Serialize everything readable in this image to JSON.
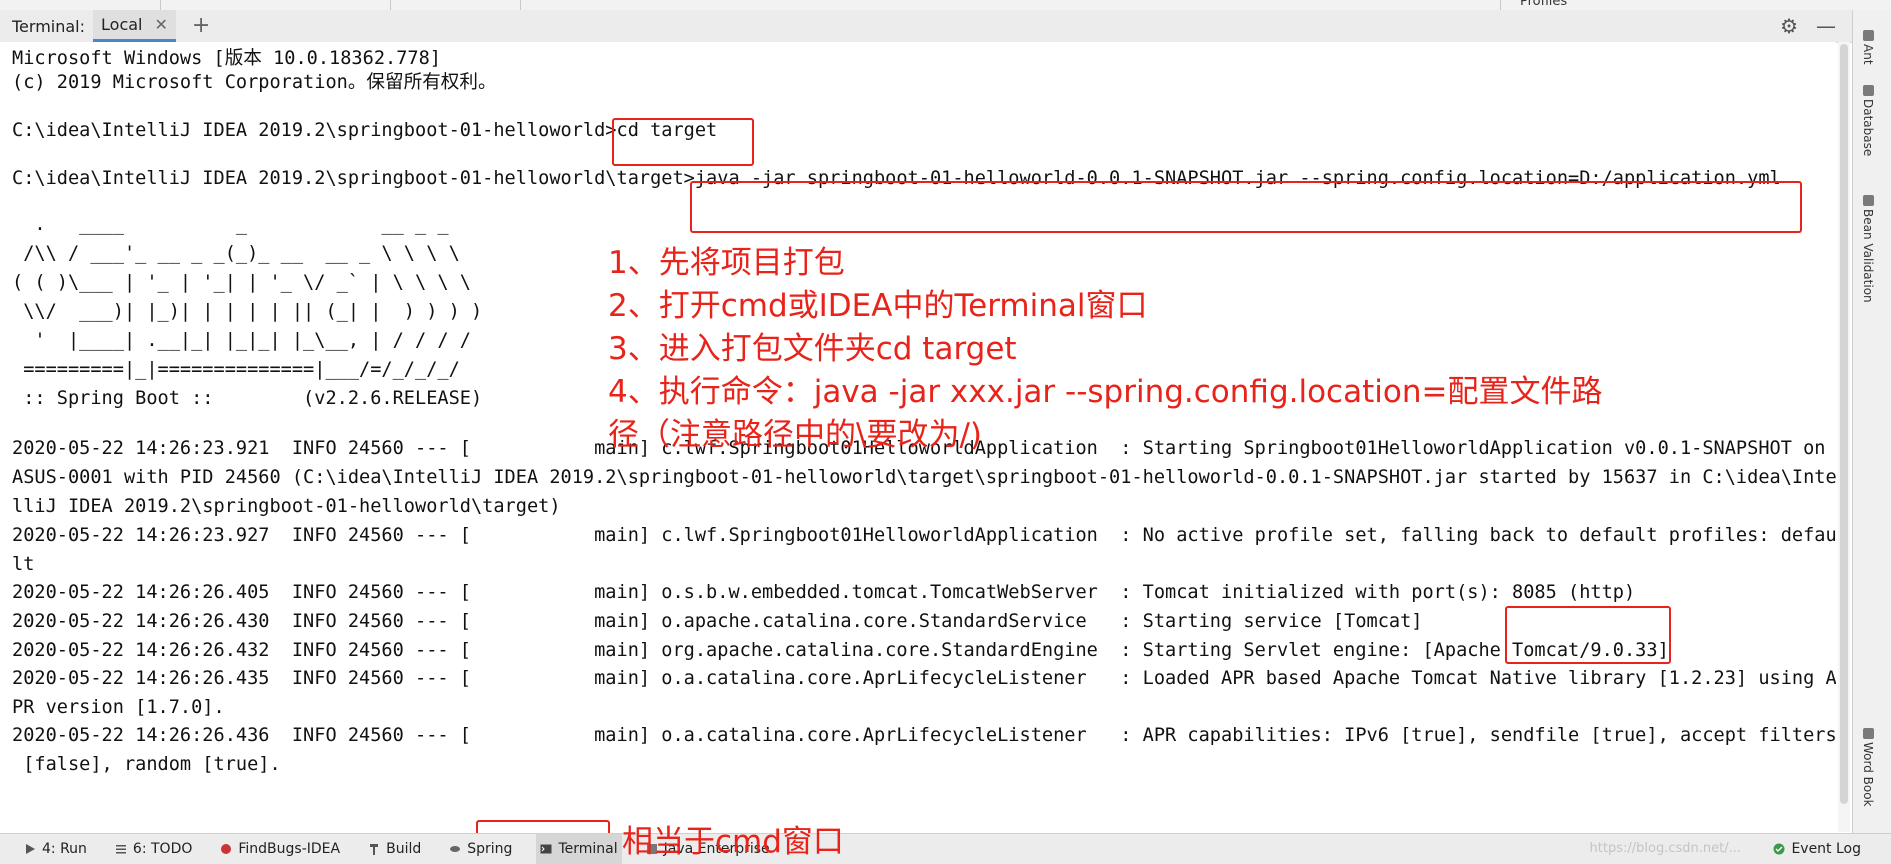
{
  "top_strip": {
    "profiles_label": "Profiles"
  },
  "tool_window": {
    "title": "Terminal:",
    "tab_local": "Local",
    "close_glyph": "✕",
    "add_glyph": "+"
  },
  "terminal": {
    "lines": [
      "Microsoft Windows [版本 10.0.18362.778]",
      "(c) 2019 Microsoft Corporation。保留所有权利。",
      "",
      "C:\\idea\\IntelliJ IDEA 2019.2\\springboot-01-helloworld>cd target",
      "",
      "C:\\idea\\IntelliJ IDEA 2019.2\\springboot-01-helloworld\\target>java -jar springboot-01-helloworld-0.0.1-SNAPSHOT.jar --spring.config.location=D:/application.yml"
    ],
    "banner": [
      "  .   ____          _            __ _ _",
      " /\\\\ / ___'_ __ _ _(_)_ __  __ _ \\ \\ \\ \\",
      "( ( )\\___ | '_ | '_| | '_ \\/ _` | \\ \\ \\ \\",
      " \\\\/  ___)| |_)| | | | | || (_| |  ) ) ) )",
      "  '  |____| .__|_| |_|_| |_\\__, | / / / /",
      " =========|_|==============|___/=/_/_/_/",
      " :: Spring Boot ::        (v2.2.6.RELEASE)"
    ],
    "log": [
      "2020-05-22 14:26:23.921  INFO 24560 --- [           main] c.lwf.Springboot01HelloworldApplication  : Starting Springboot01HelloworldApplication v0.0.1-SNAPSHOT on",
      "ASUS-0001 with PID 24560 (C:\\idea\\IntelliJ IDEA 2019.2\\springboot-01-helloworld\\target\\springboot-01-helloworld-0.0.1-SNAPSHOT.jar started by 15637 in C:\\idea\\Inte",
      "lliJ IDEA 2019.2\\springboot-01-helloworld\\target)",
      "2020-05-22 14:26:23.927  INFO 24560 --- [           main] c.lwf.Springboot01HelloworldApplication  : No active profile set, falling back to default profiles: defau",
      "lt",
      "2020-05-22 14:26:26.405  INFO 24560 --- [           main] o.s.b.w.embedded.tomcat.TomcatWebServer  : Tomcat initialized with port(s): 8085 (http)",
      "2020-05-22 14:26:26.430  INFO 24560 --- [           main] o.apache.catalina.core.StandardService   : Starting service [Tomcat]",
      "2020-05-22 14:26:26.432  INFO 24560 --- [           main] org.apache.catalina.core.StandardEngine  : Starting Servlet engine: [Apache Tomcat/9.0.33]",
      "2020-05-22 14:26:26.435  INFO 24560 --- [           main] o.a.catalina.core.AprLifecycleListener   : Loaded APR based Apache Tomcat Native library [1.2.23] using A",
      "PR version [1.7.0].",
      "2020-05-22 14:26:26.436  INFO 24560 --- [           main] o.a.catalina.core.AprLifecycleListener   : APR capabilities: IPv6 [true], sendfile [true], accept filters",
      " [false], random [true]."
    ]
  },
  "annotations": [
    "1、先将项目打包",
    "2、打开cmd或IDEA中的Terminal窗口",
    "3、进入打包文件夹cd target",
    "4、执行命令：java -jar xxx.jar --spring.config.location=配置文件路",
    "径（注意路径中的\\要改为/)"
  ],
  "bottom_annotation": "相当于cmd窗口",
  "right_rail": [
    "Ant",
    "Database",
    "Bean Validation",
    "Word Book"
  ],
  "bottom_bar": {
    "items": [
      "4: Run",
      "6: TODO",
      "FindBugs-IDEA",
      "Build",
      "Spring",
      "Terminal",
      "Java Enterprise"
    ],
    "event_log": "Event Log",
    "watermark": "https://blog.csdn.net/..."
  },
  "colors": {
    "annotation_red": "#e8231a",
    "accent_blue": "#4b86c6"
  }
}
